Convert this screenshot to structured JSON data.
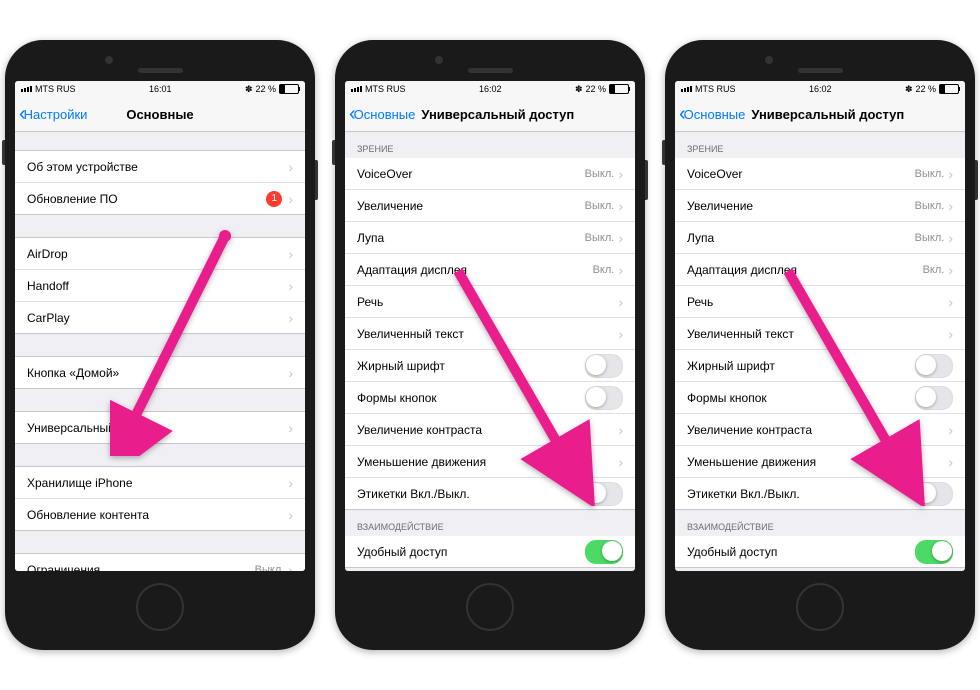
{
  "status": {
    "carrier": "MTS RUS",
    "time1": "16:01",
    "time2": "16:02",
    "battery": "22 %"
  },
  "p1": {
    "back": "Настройки",
    "title": "Основные",
    "g1": [
      {
        "l": "Об этом устройстве"
      },
      {
        "l": "Обновление ПО",
        "badge": "1"
      }
    ],
    "g2": [
      {
        "l": "AirDrop"
      },
      {
        "l": "Handoff"
      },
      {
        "l": "CarPlay"
      }
    ],
    "g3": [
      {
        "l": "Кнопка «Домой»"
      }
    ],
    "g4": [
      {
        "l": "Универсальный доступ"
      }
    ],
    "g5": [
      {
        "l": "Хранилище iPhone"
      },
      {
        "l": "Обновление контента"
      }
    ],
    "g6": [
      {
        "l": "Ограничения",
        "v": "Выкл."
      }
    ]
  },
  "p2": {
    "back": "Основные",
    "title": "Универсальный доступ",
    "h1": "Зрение",
    "g1": [
      {
        "l": "VoiceOver",
        "v": "Выкл."
      },
      {
        "l": "Увеличение",
        "v": "Выкл."
      },
      {
        "l": "Лупа",
        "v": "Выкл."
      },
      {
        "l": "Адаптация дисплея",
        "v": "Вкл."
      },
      {
        "l": "Речь"
      },
      {
        "l": "Увеличенный текст"
      },
      {
        "l": "Жирный шрифт",
        "t": false
      },
      {
        "l": "Формы кнопок",
        "t": false
      },
      {
        "l": "Увеличение контраста"
      },
      {
        "l": "Уменьшение движения"
      },
      {
        "l": "Этикетки Вкл./Выкл.",
        "t": false
      }
    ],
    "h2": "Взаимодействие",
    "g2": [
      {
        "l": "Удобный доступ",
        "t": true
      }
    ]
  }
}
